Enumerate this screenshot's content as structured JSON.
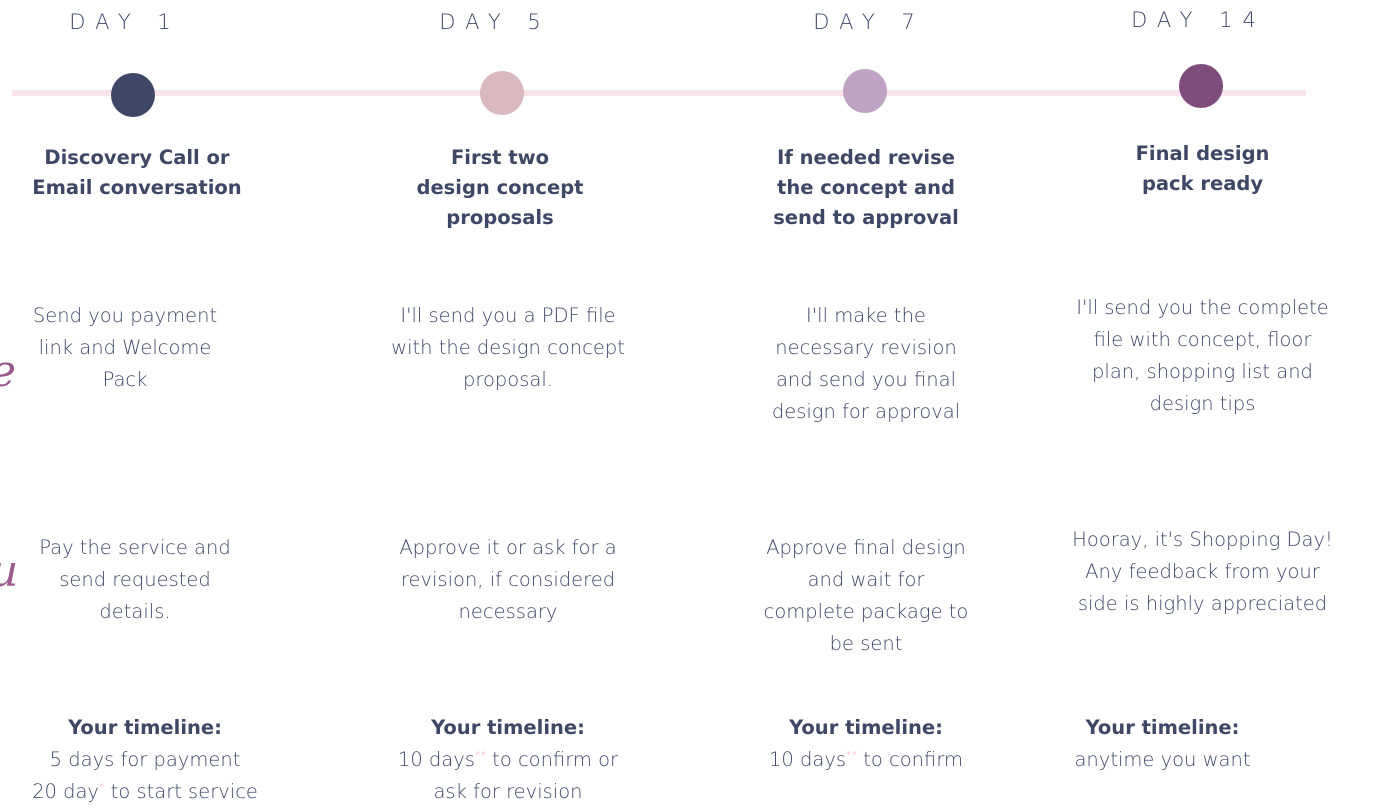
{
  "colors": {
    "text": "#3e4766",
    "line": "#f8e4ea",
    "asterisk": "#f4a3b8"
  },
  "steps": [
    {
      "day": "DAY 1",
      "dot_color": "#3e4766",
      "title_lines": [
        "Discovery Call or",
        "Email conversation"
      ],
      "client_action_lines": [
        "Send you payment",
        "link and Welcome",
        "Pack"
      ],
      "your_action_lines": [
        "Pay the service and",
        "send requested",
        "details."
      ],
      "timeline_heading": "Your timeline:",
      "timeline_lines": [
        {
          "before": "5 days for payment",
          "mark": "",
          "after": ""
        },
        {
          "before": "20 day",
          "mark": "*",
          "after": " to start service"
        }
      ]
    },
    {
      "day": "DAY 5",
      "dot_color": "#dab8bf",
      "title_lines": [
        "First two",
        "design concept",
        "proposals"
      ],
      "client_action_lines": [
        "I'll send you a PDF file",
        "with the design concept",
        "proposal."
      ],
      "your_action_lines": [
        "Approve it or ask for a",
        "revision, if considered",
        "necessary"
      ],
      "timeline_heading": "Your timeline:",
      "timeline_lines": [
        {
          "before": "10 days",
          "mark": "**",
          "after": " to confirm or"
        },
        {
          "before": "ask for revision",
          "mark": "",
          "after": ""
        }
      ]
    },
    {
      "day": "DAY 7",
      "dot_color": "#bea3c2",
      "title_lines": [
        "If needed revise",
        "the concept and",
        "send to approval"
      ],
      "client_action_lines": [
        "I'll make the",
        "necessary revision",
        "and send you final",
        "design for approval"
      ],
      "your_action_lines": [
        "Approve final design",
        "and wait for",
        "complete package to",
        "be sent"
      ],
      "timeline_heading": "Your timeline:",
      "timeline_lines": [
        {
          "before": "10 days",
          "mark": "**",
          "after": " to confirm"
        }
      ]
    },
    {
      "day": "DAY 14",
      "dot_color": "#7f4d7c",
      "title_lines": [
        "Final design",
        "pack ready"
      ],
      "client_action_lines": [
        "I'll send you the complete",
        "file with concept, floor",
        "plan, shopping list and",
        "design tips"
      ],
      "your_action_lines": [
        "Hooray, it's Shopping Day!",
        "Any feedback from your",
        "side is highly appreciated"
      ],
      "timeline_heading": "Your timeline:",
      "timeline_lines": [
        {
          "before": "anytime you want",
          "mark": "",
          "after": ""
        }
      ]
    }
  ]
}
